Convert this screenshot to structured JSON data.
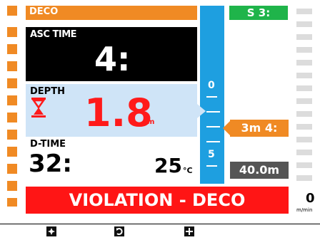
{
  "header": {
    "mode_label": "DECO"
  },
  "ascent_time": {
    "label": "ASC TIME",
    "value": "4:"
  },
  "depth": {
    "label": "DEPTH",
    "value": "1.8",
    "unit": "m"
  },
  "dive_time": {
    "label": "D-TIME",
    "value": "32:"
  },
  "temperature": {
    "value": "25",
    "unit": "°C"
  },
  "alarm": {
    "text": "VIOLATION - DECO",
    "color": "#ff1515"
  },
  "ascent_rate": {
    "value": "0",
    "unit": "m/min"
  },
  "depth_scale": {
    "labels": [
      "0",
      "5"
    ]
  },
  "safety_stop": {
    "text": "S 3:",
    "color": "#1fb44a"
  },
  "ceiling": {
    "text": "3m 4:",
    "color": "#f08a24"
  },
  "max_depth": {
    "text": "40.0m"
  },
  "bottom_buttons": [
    {
      "icon": "light-icon"
    },
    {
      "icon": "compass-icon"
    },
    {
      "icon": "plus-icon"
    }
  ],
  "colors": {
    "accent_orange": "#f08a24",
    "scale_blue": "#1e9fe0",
    "depth_red": "#ff1a1a"
  }
}
